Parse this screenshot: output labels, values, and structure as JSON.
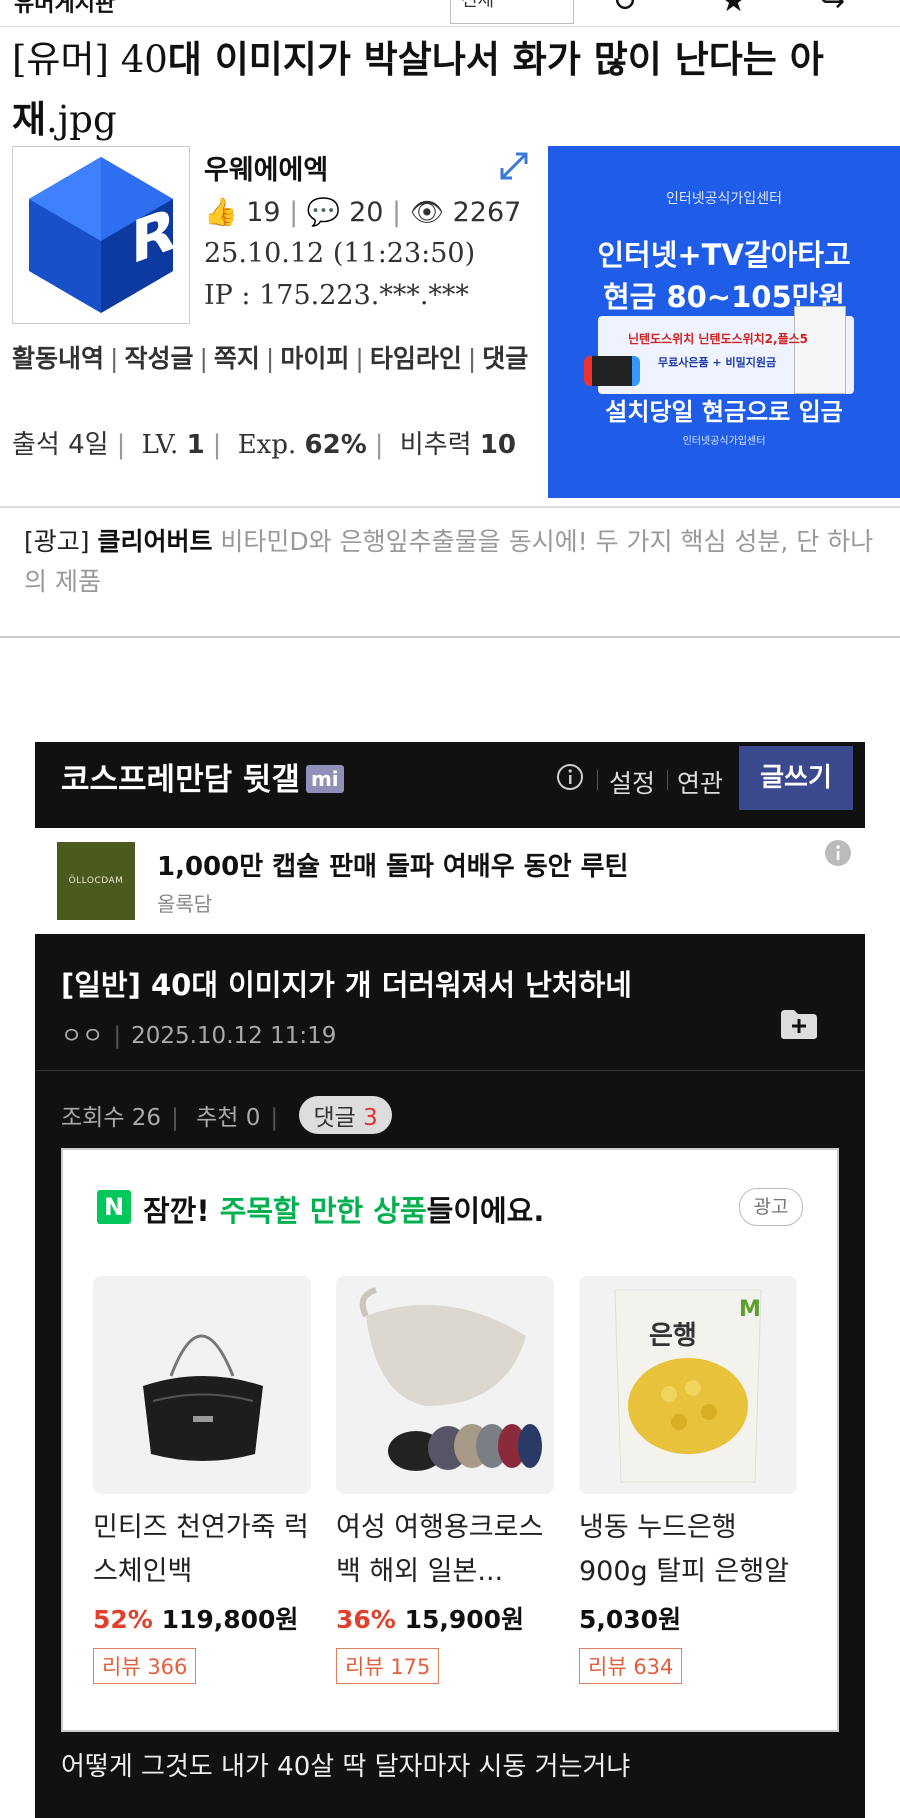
{
  "topbar": {
    "crumb": "유머게시판",
    "select_value": "전체"
  },
  "post": {
    "title_tag": "[유머]",
    "title_text_a": " 40",
    "title_text_b": "대 이미지가 박살나서 화가 많이 난다는 아재",
    "title_ext": ".jpg"
  },
  "author": {
    "nickname": "우웨에에엑",
    "likes": "19",
    "comments": "20",
    "views": "2267",
    "date": "25.10.12 (11:23:50)",
    "ip": "IP : 175.223.***.***",
    "links": [
      "활동내역",
      "작성글",
      "쪽지",
      "마이피",
      "타임라인",
      "댓글"
    ],
    "attendance": "출석 4일",
    "level_label": "LV.",
    "level": "1",
    "exp_label": "Exp.",
    "exp": "62%",
    "nonrec_label": "비추력",
    "nonrec": "10"
  },
  "banner": {
    "top": "인터넷공식가입센터",
    "line1": "인터넷+TV갈아타고",
    "line2": "현금 80~105만원",
    "box1": "닌텐도스위치 닌텐도스위치2,플스5",
    "box2": "무료사은품 + 비밀지원금",
    "bottom": "설치당일 현금으로 입금",
    "small": "인터넷공식가입센터"
  },
  "ad_row": {
    "tag": "[광고]",
    "brand": "클리어버트",
    "text": " 비타민D와 은행잎추출물을 동시에! 두 가지 핵심 성분, 단 하나의 제품"
  },
  "gallery": {
    "name": "코스프레만담 뒷갤",
    "badge": "mi",
    "settings": "설정",
    "related": "연관",
    "write": "글쓰기"
  },
  "inner_ad": {
    "logo": "ÖLLOCDAM",
    "title": "1,000만 캡슐 판매 돌파 여배우 동안 루틴",
    "sub": "올록담"
  },
  "article": {
    "tag": "[일반]",
    "title": " 40대 이미지가 개 더러워져서 난처하네",
    "author": "ㅇㅇ",
    "datetime": "2025.10.12 11:19",
    "views_label": "조회수",
    "views": "26",
    "rec_label": "추천",
    "rec": "0",
    "cmt_label": "댓글",
    "cmt": "3"
  },
  "shop": {
    "head_a": "잠깐! ",
    "head_g": "주목할 만한 상품",
    "head_b": "들이에요.",
    "ad_label": "광고",
    "products": [
      {
        "name": "민티즈 천연가죽 럭스체인백",
        "pct": "52%",
        "price": "119,800원",
        "review": "리뷰 366"
      },
      {
        "name": "여성 여행용크로스백 해외 일본...",
        "pct": "36%",
        "price": "15,900원",
        "review": "리뷰 175"
      },
      {
        "name": "냉동 누드은행 900g 탈피 은행알",
        "pct": "",
        "price": "5,030원",
        "review": "리뷰 634"
      }
    ]
  },
  "comment": "어떻게 그것도 내가 40살 딱 달자마자 시동 거는거냐",
  "colors": {
    "banner_blue": "#1f5ce8",
    "write_button": "#3b4a8f",
    "naver_green": "#03c75a",
    "discount_red": "#e0402c"
  }
}
